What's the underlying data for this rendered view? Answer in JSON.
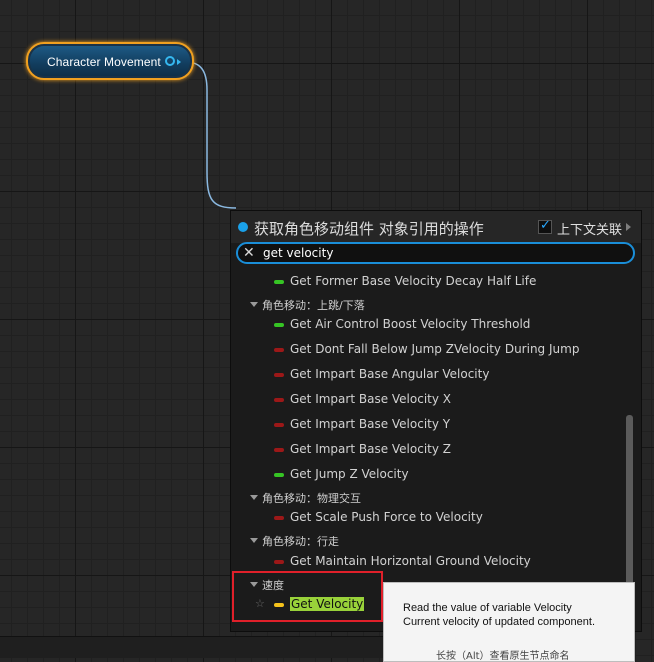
{
  "node": {
    "title": "Character Movement"
  },
  "popup": {
    "title": "获取角色移动组件 对象引用的操作",
    "context_label": "上下文关联",
    "context_checked": true,
    "search_value": "get velocity",
    "pill_colors": {
      "green": "#36c424",
      "red": "#9c1818",
      "yellow": "#f5c21b"
    },
    "items": [
      {
        "type": "item",
        "pill": "green",
        "label": "Get Former Base Velocity Decay Half Life"
      },
      {
        "type": "category",
        "label": "角色移动：上跳/下落"
      },
      {
        "type": "item",
        "pill": "green",
        "label": "Get Air Control Boost Velocity Threshold"
      },
      {
        "type": "item",
        "pill": "red",
        "label": "Get Dont Fall Below Jump ZVelocity During Jump"
      },
      {
        "type": "item",
        "pill": "red",
        "label": "Get Impart Base Angular Velocity"
      },
      {
        "type": "item",
        "pill": "red",
        "label": "Get Impart Base Velocity X"
      },
      {
        "type": "item",
        "pill": "red",
        "label": "Get Impart Base Velocity Y"
      },
      {
        "type": "item",
        "pill": "red",
        "label": "Get Impart Base Velocity Z"
      },
      {
        "type": "item",
        "pill": "green",
        "label": "Get Jump Z Velocity"
      },
      {
        "type": "category",
        "label": "角色移动：物理交互"
      },
      {
        "type": "item",
        "pill": "red",
        "label": "Get Scale Push Force to Velocity"
      },
      {
        "type": "category",
        "label": "角色移动：行走"
      },
      {
        "type": "item",
        "pill": "red",
        "label": "Get Maintain Horizontal Ground Velocity"
      },
      {
        "type": "category",
        "label": "速度"
      },
      {
        "type": "item",
        "pill": "yellow",
        "label": "Get Velocity",
        "selected": true,
        "favorite_icon": "star-icon"
      }
    ]
  },
  "tooltip": {
    "line1": "Read the value of variable Velocity",
    "line2": "Current velocity of updated component.",
    "hint": "长按（Alt）查看原生节点命名"
  }
}
